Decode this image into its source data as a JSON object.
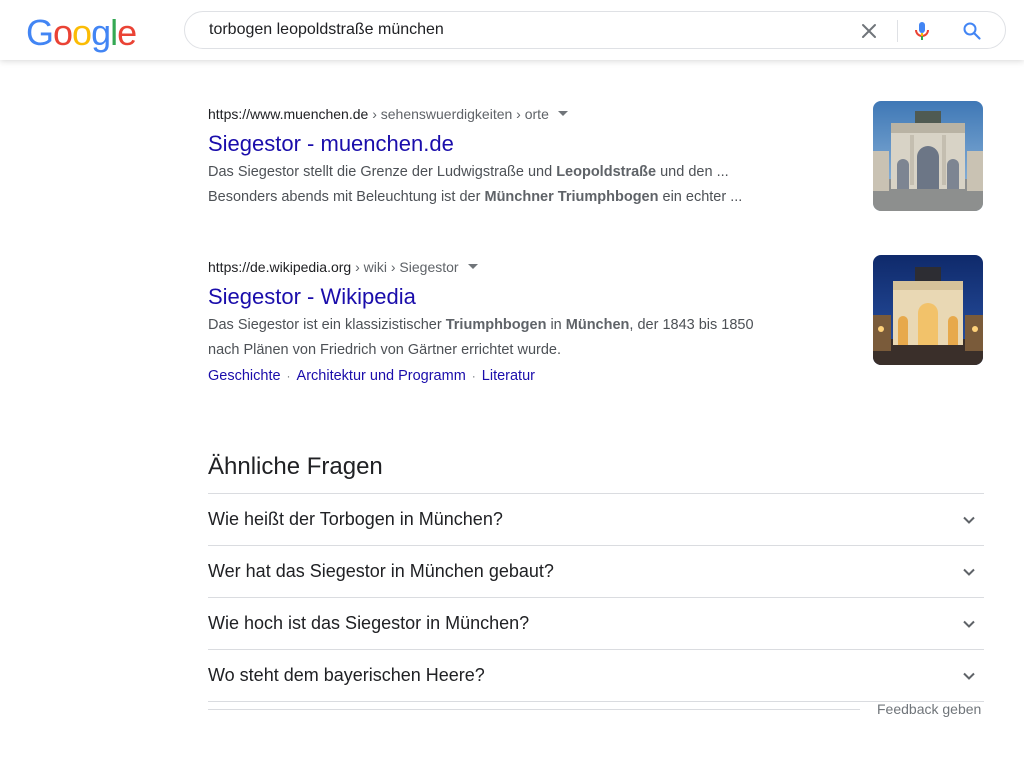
{
  "logo": {
    "letters": [
      "G",
      "o",
      "o",
      "g",
      "l",
      "e"
    ],
    "colors": [
      "#4285F4",
      "#EA4335",
      "#FBBC05",
      "#4285F4",
      "#34A853",
      "#EA4335"
    ]
  },
  "search": {
    "query": "torbogen leopoldstraße münchen",
    "clear_icon": "close-icon",
    "voice_icon": "mic-icon",
    "search_icon": "search-icon"
  },
  "results": [
    {
      "cite_domain": "https://www.muenchen.de",
      "cite_path": " › sehenswuerdigkeiten › orte",
      "title": "Siegestor - muenchen.de",
      "snippet_parts": [
        {
          "t": "Das Siegestor stellt die Grenze der Ludwigstraße und ",
          "b": false
        },
        {
          "t": "Leopoldstraße",
          "b": true
        },
        {
          "t": " und den ...",
          "b": false
        },
        {
          "t": "\n",
          "b": false
        },
        {
          "t": "Besonders abends mit Beleuchtung ist der ",
          "b": false
        },
        {
          "t": "Münchner Triumphbogen",
          "b": true
        },
        {
          "t": " ein echter ...",
          "b": false
        }
      ]
    },
    {
      "cite_domain": "https://de.wikipedia.org",
      "cite_path": " › wiki › Siegestor",
      "title": "Siegestor - Wikipedia",
      "snippet_parts": [
        {
          "t": "Das Siegestor ist ein klassizistischer ",
          "b": false
        },
        {
          "t": "Triumphbogen",
          "b": true
        },
        {
          "t": " in ",
          "b": false
        },
        {
          "t": "München",
          "b": true
        },
        {
          "t": ", der 1843 bis 1850",
          "b": false
        },
        {
          "t": "\n",
          "b": false
        },
        {
          "t": "nach Plänen von Friedrich von Gärtner errichtet wurde.",
          "b": false
        }
      ],
      "sitelinks": [
        "Geschichte",
        "Architektur und Programm",
        "Literatur"
      ]
    }
  ],
  "related": {
    "heading": "Ähnliche Fragen",
    "questions": [
      "Wie heißt der Torbogen in München?",
      "Wer hat das Siegestor in München gebaut?",
      "Wie hoch ist das Siegestor in München?",
      "Wo steht dem bayerischen Heere?"
    ],
    "chevron_icon": "chevron-down-icon"
  },
  "feedback": "Feedback geben",
  "colors": {
    "link": "#1a0dab",
    "snippet": "#4d5156",
    "divider": "#dadce0"
  }
}
